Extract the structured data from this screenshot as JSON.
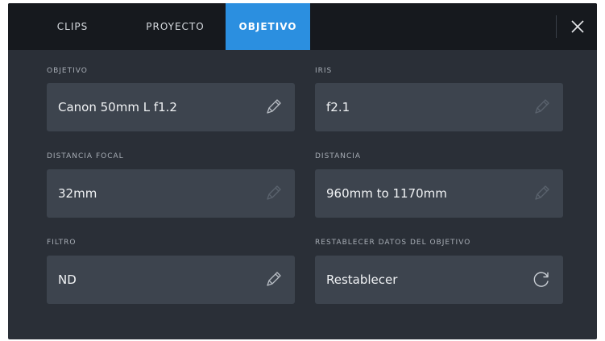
{
  "tabs": [
    {
      "label": "CLIPS",
      "active": false
    },
    {
      "label": "PROYECTO",
      "active": false
    },
    {
      "label": "OBJETIVO",
      "active": true
    }
  ],
  "fields": {
    "objetivo": {
      "label": "OBJETIVO",
      "value": "Canon 50mm L f1.2",
      "icon": "pencil-icon"
    },
    "iris": {
      "label": "IRIS",
      "value": "f2.1",
      "icon": "pencil-icon"
    },
    "distancia_focal": {
      "label": "DISTANCIA FOCAL",
      "value": "32mm",
      "icon": "pencil-icon"
    },
    "distancia": {
      "label": "DISTANCIA",
      "value": "960mm to 1170mm",
      "icon": "pencil-icon"
    },
    "filtro": {
      "label": "FILTRO",
      "value": "ND",
      "icon": "pencil-icon"
    },
    "restablecer": {
      "label": "RESTABLECER DATOS DEL OBJETIVO",
      "value": "Restablecer",
      "icon": "refresh-icon"
    }
  },
  "colors": {
    "accent": "#2b8fe0",
    "panel": "#2a2f37",
    "field": "#3d444e",
    "tabbar": "#16191e"
  }
}
